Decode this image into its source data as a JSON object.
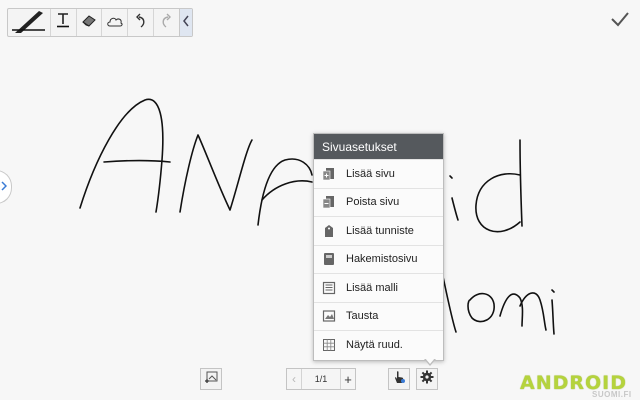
{
  "toolbar": {
    "tools": [
      {
        "name": "pen-tool",
        "icon": "pen-icon"
      },
      {
        "name": "text-tool",
        "icon": "text-icon"
      },
      {
        "name": "eraser-tool",
        "icon": "eraser-icon"
      },
      {
        "name": "lasso-tool",
        "icon": "cloud-selection-icon"
      },
      {
        "name": "undo-tool",
        "icon": "undo-icon"
      },
      {
        "name": "redo-tool",
        "icon": "redo-icon"
      },
      {
        "name": "collapse-toolbar",
        "icon": "chevron-left-icon"
      }
    ]
  },
  "confirm_icon": "checkmark-icon",
  "page_menu": {
    "title": "Sivuasetukset",
    "items": [
      {
        "label": "Lisää sivu",
        "icon": "add-page-icon"
      },
      {
        "label": "Poista sivu",
        "icon": "delete-page-icon"
      },
      {
        "label": "Lisää tunniste",
        "icon": "tag-icon"
      },
      {
        "label": "Hakemistosivu",
        "icon": "index-page-icon"
      },
      {
        "label": "Lisää malli",
        "icon": "template-icon"
      },
      {
        "label": "Tausta",
        "icon": "background-icon"
      },
      {
        "label": "Näytä ruud.",
        "icon": "grid-icon"
      }
    ]
  },
  "pager": {
    "page_count": "1/1",
    "prev": "‹",
    "add": "+"
  },
  "bottom_buttons": [
    "insert-image-icon",
    "hand-touch-icon",
    "gear-icon"
  ],
  "watermark": {
    "main": "ANDROID",
    "sub": "SUOMI.FI"
  },
  "colors": {
    "menu_header": "#55595d",
    "logo_green": "#b5d33d",
    "ink": "#111111"
  }
}
